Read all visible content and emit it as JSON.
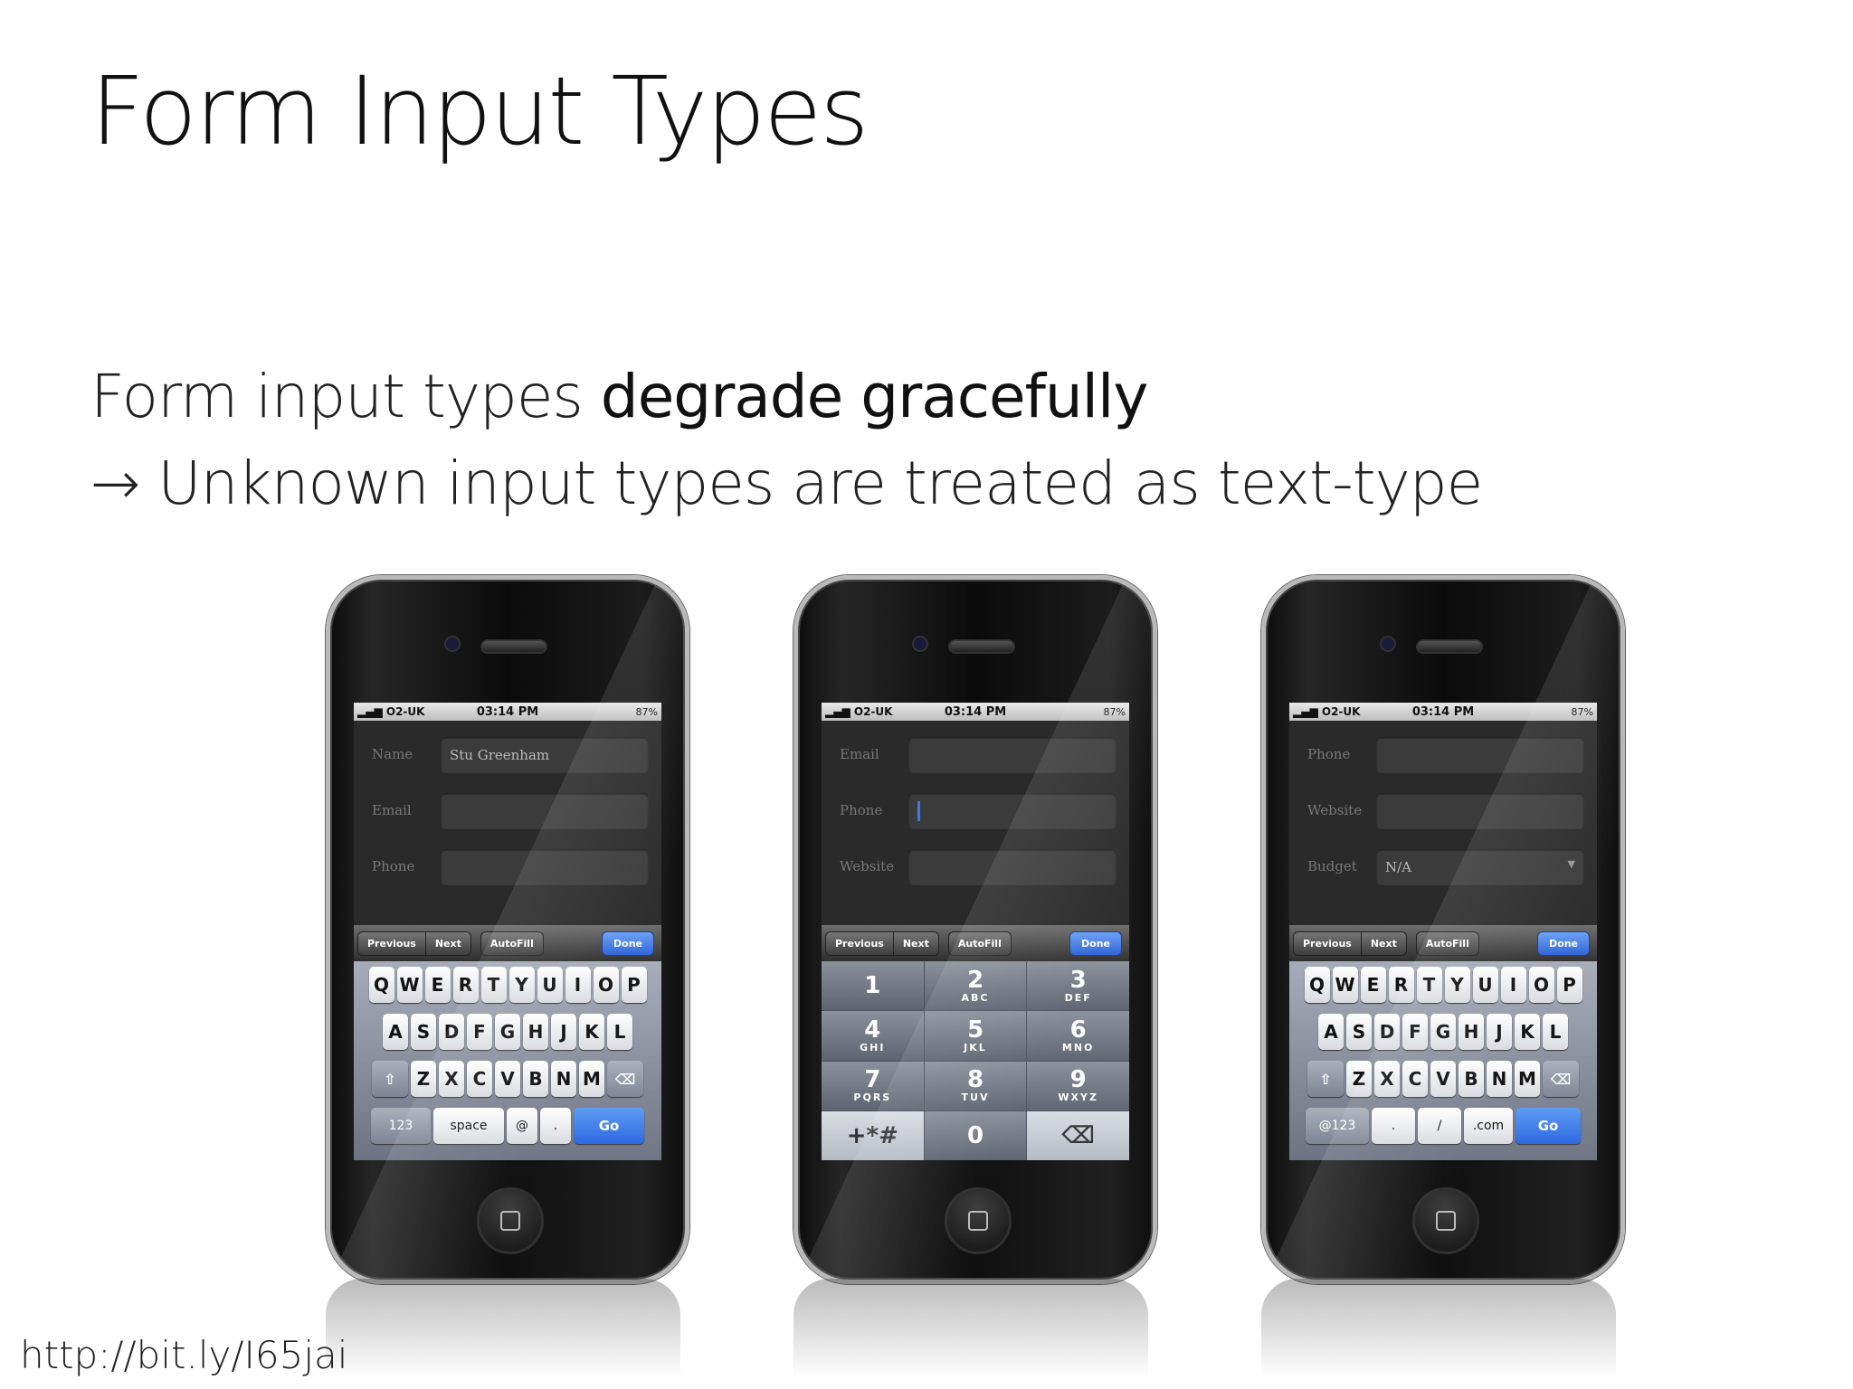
{
  "slide": {
    "title": "Form Input Types",
    "line1_plain": "Form input types ",
    "line1_bold": "degrade gracefully",
    "line2_arrow": "→",
    "line2_text": "Unknown input types are treated as text-type",
    "url": "http://bit.ly/I65jai"
  },
  "status": {
    "carrier": "O2-UK",
    "time": "03:14 PM",
    "battery": "87%"
  },
  "toolbar": {
    "previous": "Previous",
    "next": "Next",
    "autofill": "AutoFill",
    "done": "Done"
  },
  "phones": [
    {
      "fields": [
        {
          "label": "Name",
          "value": "Stu Greenham"
        },
        {
          "label": "Email",
          "value": ""
        },
        {
          "label": "Phone",
          "value": ""
        }
      ],
      "keyboard": {
        "row1": [
          "Q",
          "W",
          "E",
          "R",
          "T",
          "Y",
          "U",
          "I",
          "O",
          "P"
        ],
        "row2": [
          "A",
          "S",
          "D",
          "F",
          "G",
          "H",
          "J",
          "K",
          "L"
        ],
        "row3": [
          "Z",
          "X",
          "C",
          "V",
          "B",
          "N",
          "M"
        ],
        "bottom": [
          "123",
          "space",
          "@",
          ".",
          "Go"
        ]
      }
    },
    {
      "fields": [
        {
          "label": "Email",
          "value": ""
        },
        {
          "label": "Phone",
          "value": ""
        },
        {
          "label": "Website",
          "value": ""
        }
      ],
      "numpad": [
        {
          "d": "1",
          "l": ""
        },
        {
          "d": "2",
          "l": "ABC"
        },
        {
          "d": "3",
          "l": "DEF"
        },
        {
          "d": "4",
          "l": "GHI"
        },
        {
          "d": "5",
          "l": "JKL"
        },
        {
          "d": "6",
          "l": "MNO"
        },
        {
          "d": "7",
          "l": "PQRS"
        },
        {
          "d": "8",
          "l": "TUV"
        },
        {
          "d": "9",
          "l": "WXYZ"
        },
        {
          "d": "+*#",
          "l": ""
        },
        {
          "d": "0",
          "l": ""
        },
        {
          "d": "⌫",
          "l": ""
        }
      ]
    },
    {
      "fields": [
        {
          "label": "Phone",
          "value": ""
        },
        {
          "label": "Website",
          "value": ""
        },
        {
          "label": "Budget",
          "value": "N/A"
        }
      ],
      "keyboard": {
        "row1": [
          "Q",
          "W",
          "E",
          "R",
          "T",
          "Y",
          "U",
          "I",
          "O",
          "P"
        ],
        "row2": [
          "A",
          "S",
          "D",
          "F",
          "G",
          "H",
          "J",
          "K",
          "L"
        ],
        "row3": [
          "Z",
          "X",
          "C",
          "V",
          "B",
          "N",
          "M"
        ],
        "bottom": [
          "@123",
          ".",
          "/",
          ".com",
          "Go"
        ]
      }
    }
  ]
}
